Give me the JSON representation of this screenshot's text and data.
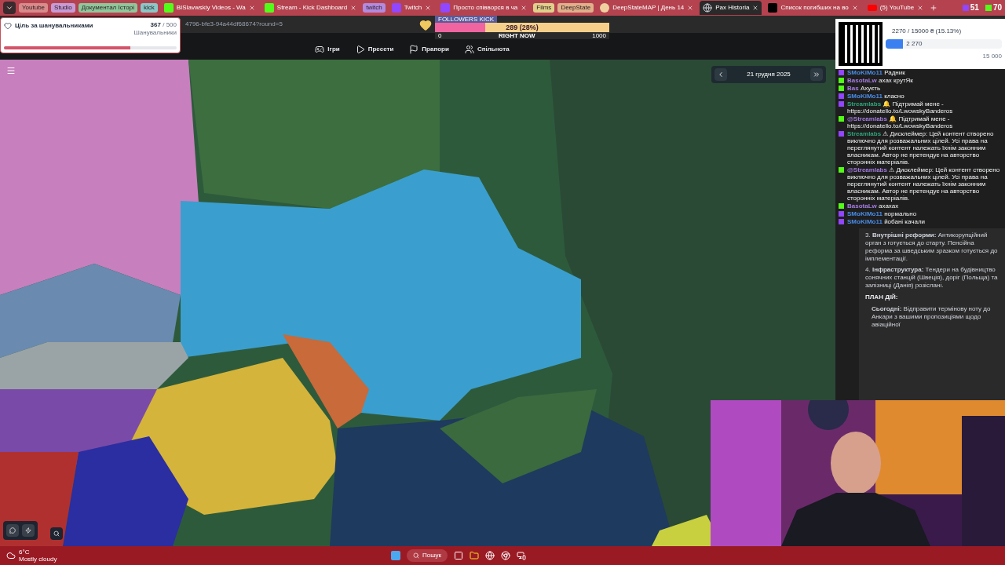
{
  "browser": {
    "tabs": [
      {
        "kind": "pill",
        "label": "Youtube",
        "color": "#d98a8a"
      },
      {
        "kind": "pill",
        "label": "Studio",
        "color": "#c79ad6"
      },
      {
        "kind": "pill",
        "label": "Документал Історі",
        "color": "#8fc79a"
      },
      {
        "kind": "pill",
        "label": "kick",
        "color": "#8ac7c7"
      },
      {
        "kind": "kick",
        "label": "BISlavwskiy Videos - Wa",
        "selected": false
      },
      {
        "kind": "kick",
        "label": "Stream - Kick Dashboard",
        "selected": false
      },
      {
        "kind": "pill",
        "label": "twitch",
        "color": "#b28ae0"
      },
      {
        "kind": "twitch",
        "label": "Twitch",
        "selected": false
      },
      {
        "kind": "twitch",
        "label": "Просто співворся в ча",
        "selected": false
      },
      {
        "kind": "pill",
        "label": "Films",
        "color": "#e0d08a"
      },
      {
        "kind": "pill",
        "label": "DeepState",
        "color": "#e0b08a"
      },
      {
        "kind": "deepstate",
        "label": "DeepStateMAP | День 14",
        "selected": false
      },
      {
        "kind": "web",
        "label": "Pax Historia",
        "selected": true
      },
      {
        "kind": "list",
        "label": "Список погибших на во",
        "selected": false
      },
      {
        "kind": "youtube",
        "label": "(5) YouTube",
        "selected": false
      }
    ],
    "url": "4796-bfe3-94a44df68674?round=5"
  },
  "nav": [
    {
      "label": "Ігри"
    },
    {
      "label": "Пресети"
    },
    {
      "label": "Прапори"
    },
    {
      "label": "Спільнота"
    }
  ],
  "date": "21 грудня 2025",
  "follower_goal": {
    "title": "Ціль за шанувальниками",
    "count": "367",
    "total": "/ 500",
    "unit": "Шанувальники",
    "level": 0.734
  },
  "kick_goal": {
    "title": "FOLLOWERS KICK",
    "value": "289 (28%)",
    "min": "0",
    "now": "RIGHT NOW",
    "max": "1000",
    "level": 0.289
  },
  "donation": {
    "text": "2270 / 15000 ₴ (15.13%)",
    "badge": "2 270",
    "max": "15 000",
    "level": 0.151
  },
  "viewers": [
    {
      "kind": "twitch",
      "count": "51"
    },
    {
      "kind": "kick",
      "count": "70"
    }
  ],
  "chat": [
    {
      "kind": "twitch",
      "user": "SMoKiMo11",
      "color": "#4a8de8",
      "text": "Радник"
    },
    {
      "kind": "kick",
      "user": "BasotaLw",
      "color": "#a47be0",
      "text": "ахах крутЯк"
    },
    {
      "kind": "kick",
      "user": "Bas",
      "color": "#a47be0",
      "text": "Ахуєть"
    },
    {
      "kind": "twitch",
      "user": "SMoKiMo11",
      "color": "#4a8de8",
      "text": "класно"
    },
    {
      "kind": "twitch",
      "user": "Streamlabs",
      "color": "#2fa37a",
      "text": "🔔 Підтримай мене - https://donatello.to/LwowskyBanderos"
    },
    {
      "kind": "kick",
      "user": "@Streamlabs",
      "color": "#a47be0",
      "text": "🔔 Підтримай мене - https://donatello.to/LwowskyBanderos"
    },
    {
      "kind": "twitch",
      "user": "Streamlabs",
      "color": "#2fa37a",
      "text": "⚠ Дисклеймер: Цей контент створено виключно для розважальних цілей. Усі права на переглянутий контент належать їхнім законним власникам. Автор не претендує на авторство сторонніх матеріалів."
    },
    {
      "kind": "kick",
      "user": "@Streamlabs",
      "color": "#a47be0",
      "text": "⚠ Дисклеймер: Цей контент створено виключно для розважальних цілей. Усі права на переглянутий контент належать їхнім законним власникам. Автор не претендує на авторство сторонніх матеріалів."
    },
    {
      "kind": "kick",
      "user": "BasotaLw",
      "color": "#a47be0",
      "text": "ахахах"
    },
    {
      "kind": "twitch",
      "user": "SMoKiMo11",
      "color": "#4a8de8",
      "text": "нормально"
    },
    {
      "kind": "twitch",
      "user": "SMoKiMo11",
      "color": "#4a8de8",
      "text": "йобані качали"
    }
  ],
  "report": [
    {
      "kind": "item",
      "text": "3. **Внутрішні реформи:** Антикорупційний орган з готується до старту. Пенсійна реформа за шведським зразком готується до імплементації."
    },
    {
      "kind": "item",
      "text": "4. **Інфраструктура:** Тендери на будівництво сонячних станцій (Швеція), доріг (Польща) та залізниці (Данія) розіслані."
    },
    {
      "kind": "heading",
      "text": "ПЛАН ДІЙ:"
    },
    {
      "kind": "bullet",
      "text": "**Сьогодні:** Відправити термінову ноту до Анкари з вашими пропозиціями щодо авіаційної"
    }
  ],
  "taskbar": {
    "temp": "6°C",
    "weather": "Mostly cloudy",
    "search": "Пошук"
  }
}
